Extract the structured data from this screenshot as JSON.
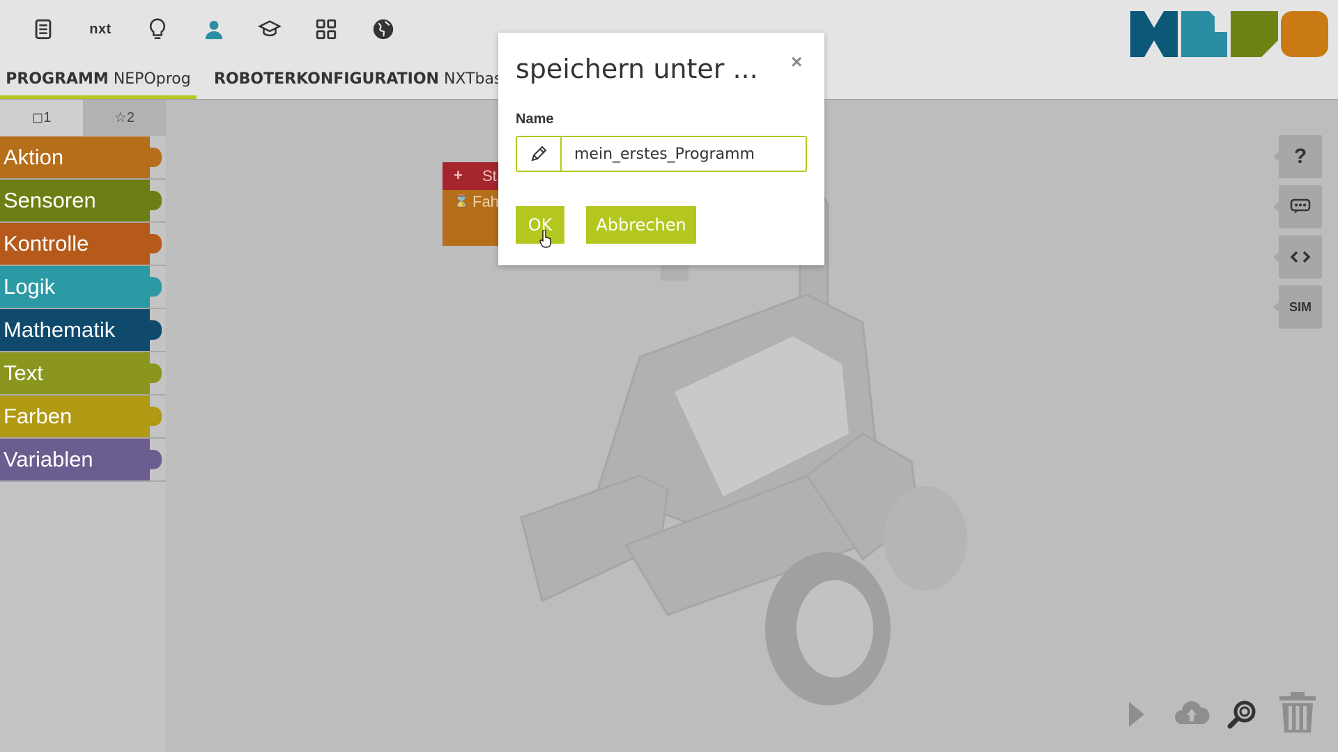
{
  "toolbar": {
    "robot_label": "nxt",
    "icons": [
      "document-icon",
      "nxt-label",
      "lightbulb-icon",
      "user-icon",
      "graduation-cap-icon",
      "gallery-icon",
      "globe-icon"
    ]
  },
  "tabs": {
    "program_prefix": "PROGRAMM",
    "program_name": "NEPOprog",
    "robot_prefix": "ROBOTERKONFIGURATION",
    "robot_name": "NXTbasis"
  },
  "palette": {
    "tab1": "◻1",
    "tab2": "☆2",
    "categories": [
      {
        "label": "Aktion",
        "color": "#b56e1a"
      },
      {
        "label": "Sensoren",
        "color": "#6c7f14"
      },
      {
        "label": "Kontrolle",
        "color": "#b55a1a"
      },
      {
        "label": "Logik",
        "color": "#2b9aa5"
      },
      {
        "label": "Mathematik",
        "color": "#0f4a6d"
      },
      {
        "label": "Text",
        "color": "#8a961e"
      },
      {
        "label": "Farben",
        "color": "#b09a14"
      },
      {
        "label": "Variablen",
        "color": "#6b5d8f"
      }
    ]
  },
  "blocks": {
    "start": "St",
    "drive": "Fah"
  },
  "side_buttons": {
    "help": "?",
    "sim": "SIM"
  },
  "dialog": {
    "title": "speichern unter ...",
    "close": "×",
    "name_label": "Name",
    "name_value": "mein_erstes_Programm",
    "ok": "OK",
    "cancel": "Abbrechen"
  },
  "colors": {
    "accent": "#b4c71f",
    "logo": [
      "#0b5878",
      "#2a8da1",
      "#6d8314",
      "#c97a14"
    ]
  }
}
